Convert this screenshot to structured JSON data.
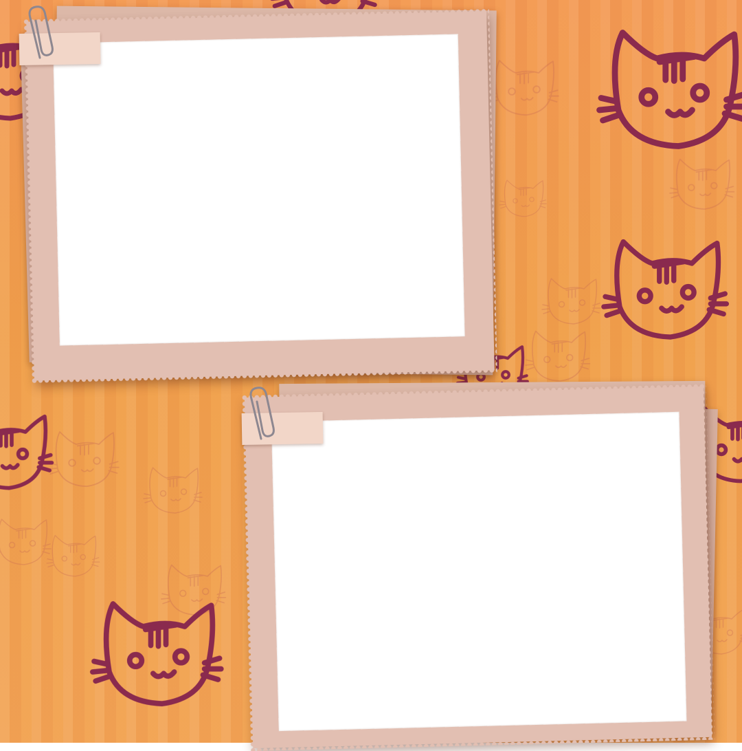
{
  "scene": {
    "background_color": "#f09c52",
    "pattern_color": "#8a2a4e",
    "frame_color": "#e2bfb2",
    "photo_color": "#ffffff",
    "motif": "cat-face",
    "frames": [
      {
        "name": "top-left-photo-frame",
        "slot": "empty-photo-slot"
      },
      {
        "name": "bottom-right-photo-frame",
        "slot": "empty-photo-slot"
      }
    ]
  }
}
